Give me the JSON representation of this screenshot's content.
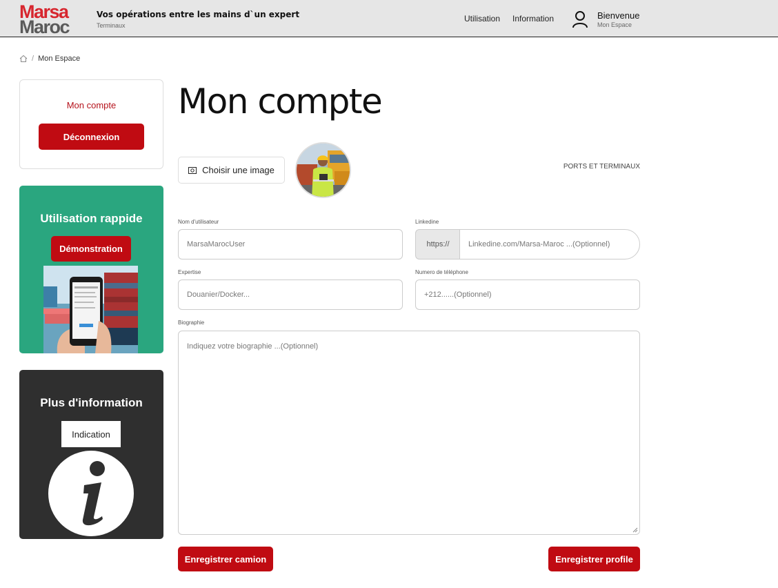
{
  "header": {
    "logo_line1": "Marsa",
    "logo_line2": "Maroc",
    "tagline": "Vos opérations entre les mains d`un expert",
    "tagline_sub": "Terminaux",
    "nav": [
      "Utilisation",
      "Information"
    ],
    "welcome": "Bienvenue",
    "welcome_sub": "Mon Espace"
  },
  "breadcrumb": {
    "separator": "/",
    "current": "Mon Espace"
  },
  "sidebar": {
    "account_title": "Mon compte",
    "logout_label": "Déconnexion",
    "quick_title": "Utilisation rappide",
    "demo_label": "Démonstration",
    "info_title": "Plus d'information",
    "indication_label": "Indication"
  },
  "main": {
    "title": "Mon compte",
    "choose_image_label": "Choisir une image",
    "company": "PORTS ET TERMINAUX",
    "fields": {
      "username": {
        "label": "Nom d'utilisateur",
        "placeholder": "MarsaMarocUser"
      },
      "linkedin": {
        "label": "Linkedine",
        "prefix": "https://",
        "placeholder": "Linkedine.com/Marsa-Maroc ...(Optionnel)"
      },
      "expertise": {
        "label": "Expertise",
        "placeholder": "Douanier/Docker..."
      },
      "phone": {
        "label": "Numero de téléphone",
        "placeholder": "+212......(Optionnel)"
      },
      "bio": {
        "label": "Biographie",
        "placeholder": "Indiquez votre biographie ...(Optionnel)"
      }
    },
    "save_truck_label": "Enregistrer camion",
    "save_profile_label": "Enregistrer profile"
  },
  "colors": {
    "brand_red": "#c00b12",
    "quick_green": "#2aa67f",
    "info_dark": "#2f2f2f",
    "header_bg": "#e6e6e6"
  }
}
